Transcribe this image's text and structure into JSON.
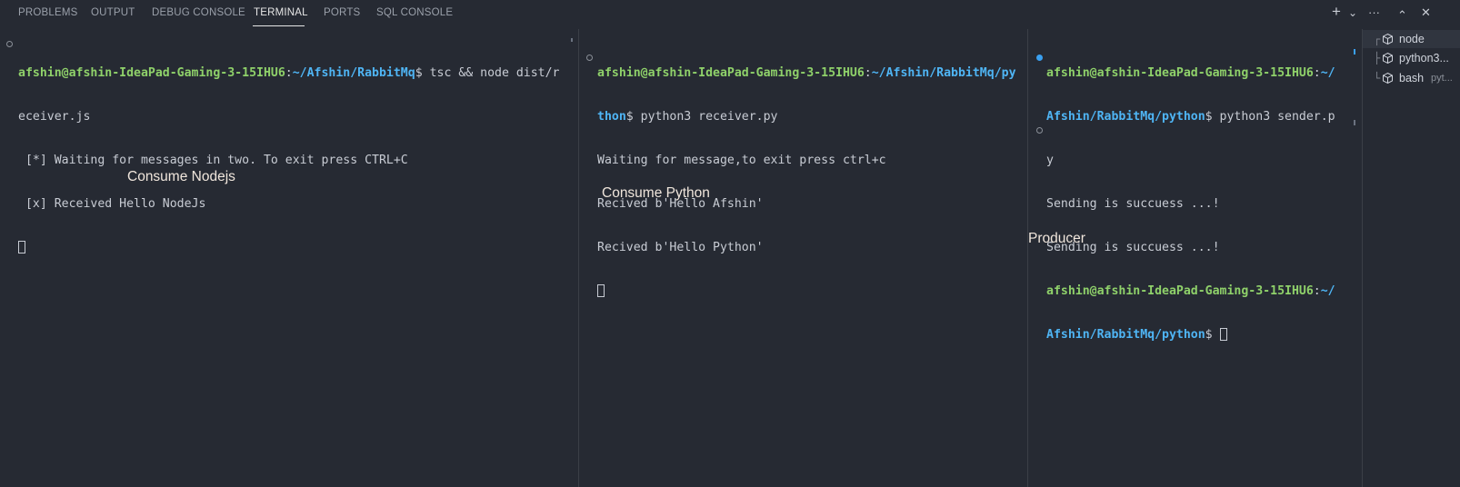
{
  "tabs": [
    {
      "label": "PROBLEMS"
    },
    {
      "label": "OUTPUT"
    },
    {
      "label": "DEBUG CONSOLE"
    },
    {
      "label": "TERMINAL"
    },
    {
      "label": "PORTS"
    },
    {
      "label": "SQL CONSOLE"
    }
  ],
  "active_tab": "TERMINAL",
  "actions": {
    "add": "+",
    "dropdown": "⌄",
    "more": "···",
    "maximize": "⌃",
    "close": "✕"
  },
  "terminals": {
    "node": {
      "user": "afshin@afshin-IdeaPad-Gaming-3-15IHU6",
      "colon": ":",
      "path": "~/Afshin/RabbitMq",
      "cmd": "$ tsc && node dist/r",
      "cmd_wrap": "eceiver.js",
      "out1": " [*] Waiting for messages in two. To exit press CTRL+C",
      "out2": " [x] Received Hello NodeJs"
    },
    "python": {
      "user": "afshin@afshin-IdeaPad-Gaming-3-15IHU6",
      "colon": ":",
      "path": "~/Afshin/RabbitMq/py",
      "path_wrap": "thon",
      "cmd": "$ python3 receiver.py",
      "out1": "Waiting for message,to exit press ctrl+c",
      "out2": "Recived b'Hello Afshin'",
      "out3": "Recived b'Hello Python'"
    },
    "producer": {
      "user": "afshin@afshin-IdeaPad-Gaming-3-15IHU6",
      "colon": ":",
      "path_a": "~/",
      "path_b": "Afshin/RabbitMq/python",
      "cmd": "$ python3 sender.p",
      "cmd_wrap": "y",
      "out1": "Sending is succuess ...!",
      "out2": "Sending is succuess ...!",
      "user2": "afshin@afshin-IdeaPad-Gaming-3-15IHU6",
      "colon2": ":",
      "path2_a": "~/",
      "path2_b": "Afshin/RabbitMq/python",
      "prompt2_end": "$ "
    }
  },
  "annotations": {
    "node": "Consume Nodejs",
    "python": "Consume Python",
    "producer": "Producer"
  },
  "terminal_list": [
    {
      "name": "node",
      "tree": "┌"
    },
    {
      "name": "python3...",
      "tree": "├"
    },
    {
      "name": "bash",
      "detail": "pyt...",
      "tree": "└"
    }
  ],
  "colors": {
    "background": "#262a33",
    "user": "#8fd16a",
    "path": "#4fb5f5"
  }
}
